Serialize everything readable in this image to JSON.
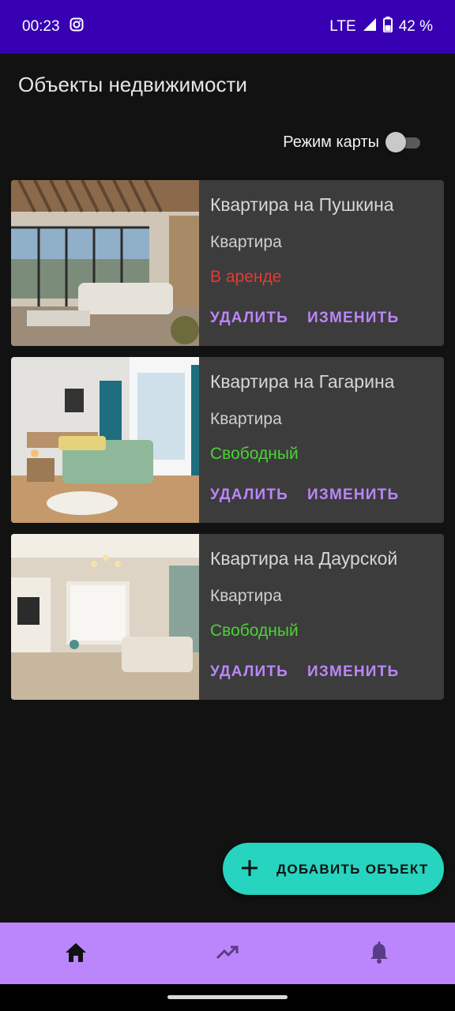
{
  "status_bar": {
    "time": "00:23",
    "network": "LTE",
    "battery": "42 %"
  },
  "app_title": "Объекты недвижимости",
  "map_mode": {
    "label": "Режим карты",
    "enabled": false
  },
  "cards": [
    {
      "title": "Квартира на Пушкина",
      "type": "Квартира",
      "status": "В аренде",
      "status_color": "#e53935",
      "delete_label": "УДАЛИТЬ",
      "edit_label": "ИЗМЕНИТЬ"
    },
    {
      "title": "Квартира на Гагарина",
      "type": "Квартира",
      "status": "Свободный",
      "status_color": "#4cd137",
      "delete_label": "УДАЛИТЬ",
      "edit_label": "ИЗМЕНИТЬ"
    },
    {
      "title": "Квартира на Даурской",
      "type": "Квартира",
      "status": "Свободный",
      "status_color": "#4cd137",
      "delete_label": "УДАЛИТЬ",
      "edit_label": "ИЗМЕНИТЬ"
    }
  ],
  "fab": {
    "label": "ДОБАВИТЬ ОБЪЕКТ",
    "icon": "plus-icon"
  },
  "bottom_nav": {
    "items": [
      {
        "icon": "home-icon",
        "selected": true
      },
      {
        "icon": "trending-up-icon",
        "selected": false
      },
      {
        "icon": "bell-icon",
        "selected": false
      }
    ]
  },
  "colors": {
    "accent": "#bb86fc",
    "status_bar": "#3700b3",
    "fab": "#26d4c0",
    "card": "#3c3c3c",
    "background": "#121212"
  }
}
